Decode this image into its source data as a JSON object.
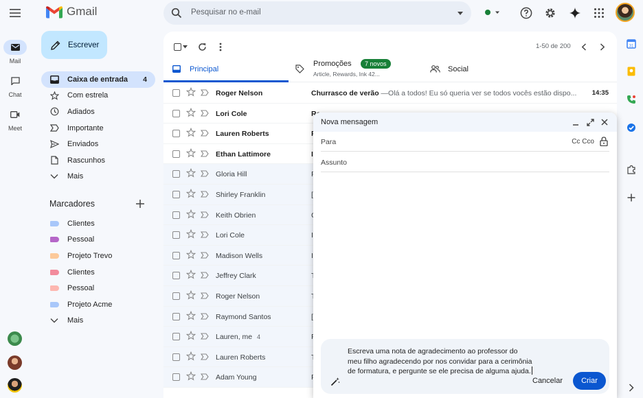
{
  "app": {
    "logo_text": "Gmail",
    "search_placeholder": "Pesquisar no e-mail"
  },
  "rail": {
    "items": [
      {
        "label": "Mail",
        "icon": "mail-icon"
      },
      {
        "label": "Chat",
        "icon": "chat-icon"
      },
      {
        "label": "Meet",
        "icon": "video-icon"
      }
    ]
  },
  "sidebar": {
    "compose_label": "Escrever",
    "nav": [
      {
        "label": "Caixa de entrada",
        "count": "4",
        "icon": "inbox-icon"
      },
      {
        "label": "Com estrela",
        "icon": "star-icon"
      },
      {
        "label": "Adiados",
        "icon": "clock-icon"
      },
      {
        "label": "Importante",
        "icon": "important-icon"
      },
      {
        "label": "Enviados",
        "icon": "send-icon"
      },
      {
        "label": "Rascunhos",
        "icon": "draft-icon"
      },
      {
        "label": "Mais",
        "icon": "chevron-down-icon"
      }
    ],
    "labels_title": "Marcadores",
    "labels": [
      {
        "label": "Clientes",
        "color": "#a8c7fa"
      },
      {
        "label": "Pessoal",
        "color": "#b566c8"
      },
      {
        "label": "Projeto Trevo",
        "color": "#fcc99a"
      },
      {
        "label": "Clientes",
        "color": "#f28b9c"
      },
      {
        "label": "Pessoal",
        "color": "#fdb7b0"
      },
      {
        "label": "Projeto Acme",
        "color": "#a8c7fa"
      },
      {
        "label": "Mais",
        "color": ""
      }
    ]
  },
  "toolbar": {
    "pager": "1-50 de 200"
  },
  "tabs": {
    "principal": "Principal",
    "promocoes": "Promoções",
    "promocoes_badge": "7 novos",
    "promocoes_sub": "Article, Rewards, Ink 42...",
    "social": "Social"
  },
  "emails": [
    {
      "sender": "Roger Nelson",
      "subject": "Churrasco de verão",
      "snippet": " —Olá a todos! Eu só queria ver se todos vocês estão dispo...",
      "time": "14:35",
      "unread": true
    },
    {
      "sender": "Lori Cole",
      "subject": "Re",
      "snippet": "",
      "time": "",
      "unread": true
    },
    {
      "sender": "Lauren Roberts",
      "subject": "F",
      "snippet": "",
      "time": "",
      "unread": true
    },
    {
      "sender": "Ethan Lattimore",
      "subject": "I",
      "snippet": "",
      "time": "",
      "unread": true
    },
    {
      "sender": "Gloria Hill",
      "subject": "F",
      "snippet": "",
      "time": "",
      "unread": false
    },
    {
      "sender": "Shirley Franklin",
      "subject": "[",
      "snippet": "",
      "time": "",
      "unread": false
    },
    {
      "sender": "Keith Obrien",
      "subject": "C",
      "snippet": "",
      "time": "",
      "unread": false
    },
    {
      "sender": "Lori Cole",
      "subject": "I",
      "snippet": "",
      "time": "",
      "unread": false
    },
    {
      "sender": "Madison Wells",
      "subject": "I",
      "snippet": "",
      "time": "",
      "unread": false
    },
    {
      "sender": "Jeffrey Clark",
      "subject": "T",
      "snippet": "",
      "time": "",
      "unread": false
    },
    {
      "sender": "Roger Nelson",
      "subject": "T",
      "snippet": "",
      "time": "",
      "unread": false
    },
    {
      "sender": "Raymond Santos",
      "subject": "[",
      "snippet": "",
      "time": "",
      "unread": false
    },
    {
      "sender": "Lauren, me",
      "sender_count": "4",
      "subject": "F",
      "snippet": "",
      "time": "",
      "unread": false
    },
    {
      "sender": "Lauren Roberts",
      "subject": "T",
      "snippet": "",
      "time": "",
      "unread": false
    },
    {
      "sender": "Adam Young",
      "subject": "F",
      "snippet": "",
      "time": "",
      "unread": false
    }
  ],
  "compose": {
    "title": "Nova mensagem",
    "to_label": "Para",
    "cc_bcc": "Cc  Cco",
    "subject_label": "Assunto",
    "ai_prompt": "Escreva uma nota de agradecimento ao professor do meu filho agradecendo por nos convidar para a cerimônia de formatura, e pergunte se ele precisa de alguma ajuda.",
    "cancel_label": "Cancelar",
    "create_label": "Criar"
  }
}
